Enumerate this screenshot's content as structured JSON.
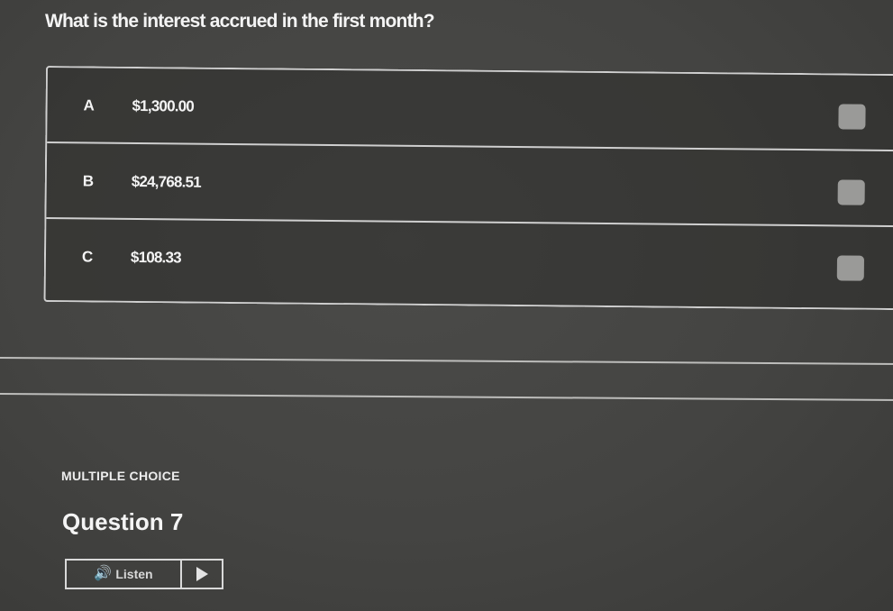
{
  "question": {
    "text": "What is the interest accrued in the first month?",
    "type": "MULTIPLE CHOICE",
    "number": "Question 7"
  },
  "options": [
    {
      "letter": "A",
      "value": "$1,300.00"
    },
    {
      "letter": "B",
      "value": "$24,768.51"
    },
    {
      "letter": "C",
      "value": "$108.33"
    }
  ],
  "listen": {
    "label": "Listen",
    "icons": {
      "speaker": "speaker-icon",
      "play": "play-icon"
    }
  },
  "colors": {
    "background": "#444442",
    "text": "#f4f4f4",
    "border": "#cfcfcf",
    "checkbox": "#9a9a98"
  }
}
